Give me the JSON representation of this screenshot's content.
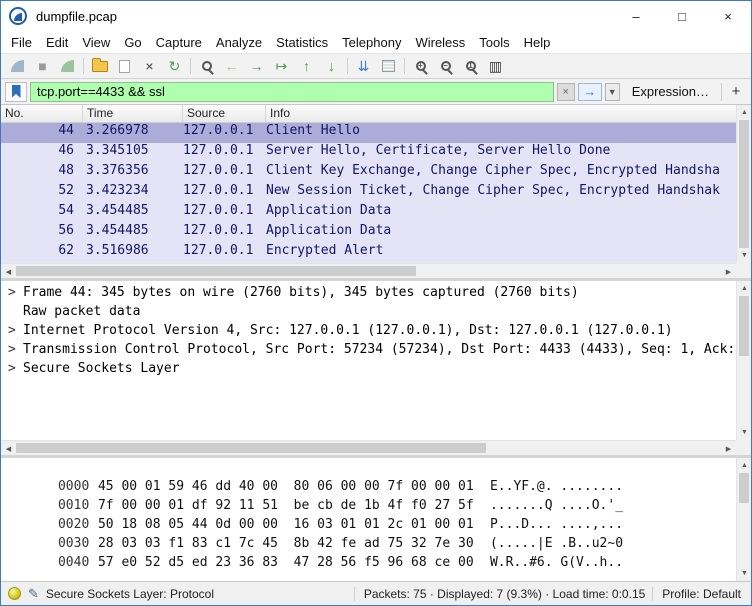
{
  "window": {
    "title": "dumpfile.pcap",
    "controls": {
      "minimize": "–",
      "maximize": "□",
      "close": "×"
    }
  },
  "menu": {
    "items": [
      "File",
      "Edit",
      "View",
      "Go",
      "Capture",
      "Analyze",
      "Statistics",
      "Telephony",
      "Wireless",
      "Tools",
      "Help"
    ]
  },
  "toolbar": {
    "buttons": [
      {
        "name": "start-capture",
        "glyph": ""
      },
      {
        "name": "stop-capture",
        "glyph": "■"
      },
      {
        "name": "restart-capture",
        "glyph": ""
      },
      {
        "name": "open-file",
        "glyph": ""
      },
      {
        "name": "save-file",
        "glyph": ""
      },
      {
        "name": "close-file",
        "glyph": "×"
      },
      {
        "name": "reload-file",
        "glyph": "↻"
      },
      {
        "name": "find-packet",
        "glyph": ""
      },
      {
        "name": "go-back",
        "glyph": "←"
      },
      {
        "name": "go-forward",
        "glyph": "→"
      },
      {
        "name": "go-to-packet",
        "glyph": "↦"
      },
      {
        "name": "go-first-packet",
        "glyph": "↑"
      },
      {
        "name": "go-last-packet",
        "glyph": "↓"
      },
      {
        "name": "auto-scroll",
        "glyph": "⇊"
      },
      {
        "name": "colorize-packets",
        "glyph": ""
      },
      {
        "name": "zoom-in",
        "glyph": "+"
      },
      {
        "name": "zoom-out",
        "glyph": "−"
      },
      {
        "name": "zoom-normal",
        "glyph": "1"
      },
      {
        "name": "resize-columns",
        "glyph": "▥"
      }
    ]
  },
  "filter_bar": {
    "value": "tcp.port==4433 && ssl",
    "clear_glyph": "×",
    "apply_glyph": "→",
    "dropdown_glyph": "▼",
    "expression_label": "Expression…",
    "add_label": "+"
  },
  "packet_list": {
    "columns": [
      "No.",
      "Time",
      "Source",
      "Info"
    ],
    "selected_row_index": 0,
    "rows": [
      {
        "no": "44",
        "time": "3.266978",
        "source": "127.0.0.1",
        "info": "Client Hello"
      },
      {
        "no": "46",
        "time": "3.345105",
        "source": "127.0.0.1",
        "info": "Server Hello, Certificate, Server Hello Done"
      },
      {
        "no": "48",
        "time": "3.376356",
        "source": "127.0.0.1",
        "info": "Client Key Exchange, Change Cipher Spec, Encrypted Handsha"
      },
      {
        "no": "52",
        "time": "3.423234",
        "source": "127.0.0.1",
        "info": "New Session Ticket, Change Cipher Spec, Encrypted Handshak"
      },
      {
        "no": "54",
        "time": "3.454485",
        "source": "127.0.0.1",
        "info": "Application Data"
      },
      {
        "no": "56",
        "time": "3.454485",
        "source": "127.0.0.1",
        "info": "Application Data"
      },
      {
        "no": "62",
        "time": "3.516986",
        "source": "127.0.0.1",
        "info": "Encrypted Alert"
      }
    ]
  },
  "packet_details": {
    "lines": [
      {
        "expander": ">",
        "text": "Frame 44: 345 bytes on wire (2760 bits), 345 bytes captured (2760 bits)"
      },
      {
        "expander": "",
        "text": "Raw packet data"
      },
      {
        "expander": ">",
        "text": "Internet Protocol Version 4, Src: 127.0.0.1 (127.0.0.1), Dst: 127.0.0.1 (127.0.0.1)"
      },
      {
        "expander": ">",
        "text": "Transmission Control Protocol, Src Port: 57234 (57234), Dst Port: 4433 (4433), Seq: 1, Ack:"
      },
      {
        "expander": ">",
        "text": "Secure Sockets Layer"
      }
    ]
  },
  "hex_view": {
    "rows": [
      {
        "offset": "0000",
        "hex": "45 00 01 59 46 dd 40 00  80 06 00 00 7f 00 00 01",
        "ascii": "E..YF.@. ........"
      },
      {
        "offset": "0010",
        "hex": "7f 00 00 01 df 92 11 51  be cb de 1b 4f f0 27 5f",
        "ascii": ".......Q ....O.'_"
      },
      {
        "offset": "0020",
        "hex": "50 18 08 05 44 0d 00 00  16 03 01 01 2c 01 00 01",
        "ascii": "P...D... ....,..."
      },
      {
        "offset": "0030",
        "hex": "28 03 03 f1 83 c1 7c 45  8b 42 fe ad 75 32 7e 30",
        "ascii": "(.....|E .B..u2~0"
      },
      {
        "offset": "0040",
        "hex": "57 e0 52 d5 ed 23 36 83  47 28 56 f5 96 68 ce 00",
        "ascii": "W.R..#6. G(V..h.."
      }
    ]
  },
  "status_bar": {
    "field_text": "Secure Sockets Layer: Protocol",
    "packets_text": "Packets: 75 · Displayed: 7 (9.3%) · Load time: 0:0.15",
    "profile_text": "Profile: Default"
  },
  "scrollbar": {
    "up": "▲",
    "down": "▼",
    "left": "◀",
    "right": "▶"
  },
  "colors": {
    "filter_valid_bg": "#afffaf",
    "packet_row_bg": "#e4e4f6",
    "packet_row_selected_bg": "#acacd8",
    "packet_row_text": "#14146a",
    "window_border": "#4178be"
  }
}
